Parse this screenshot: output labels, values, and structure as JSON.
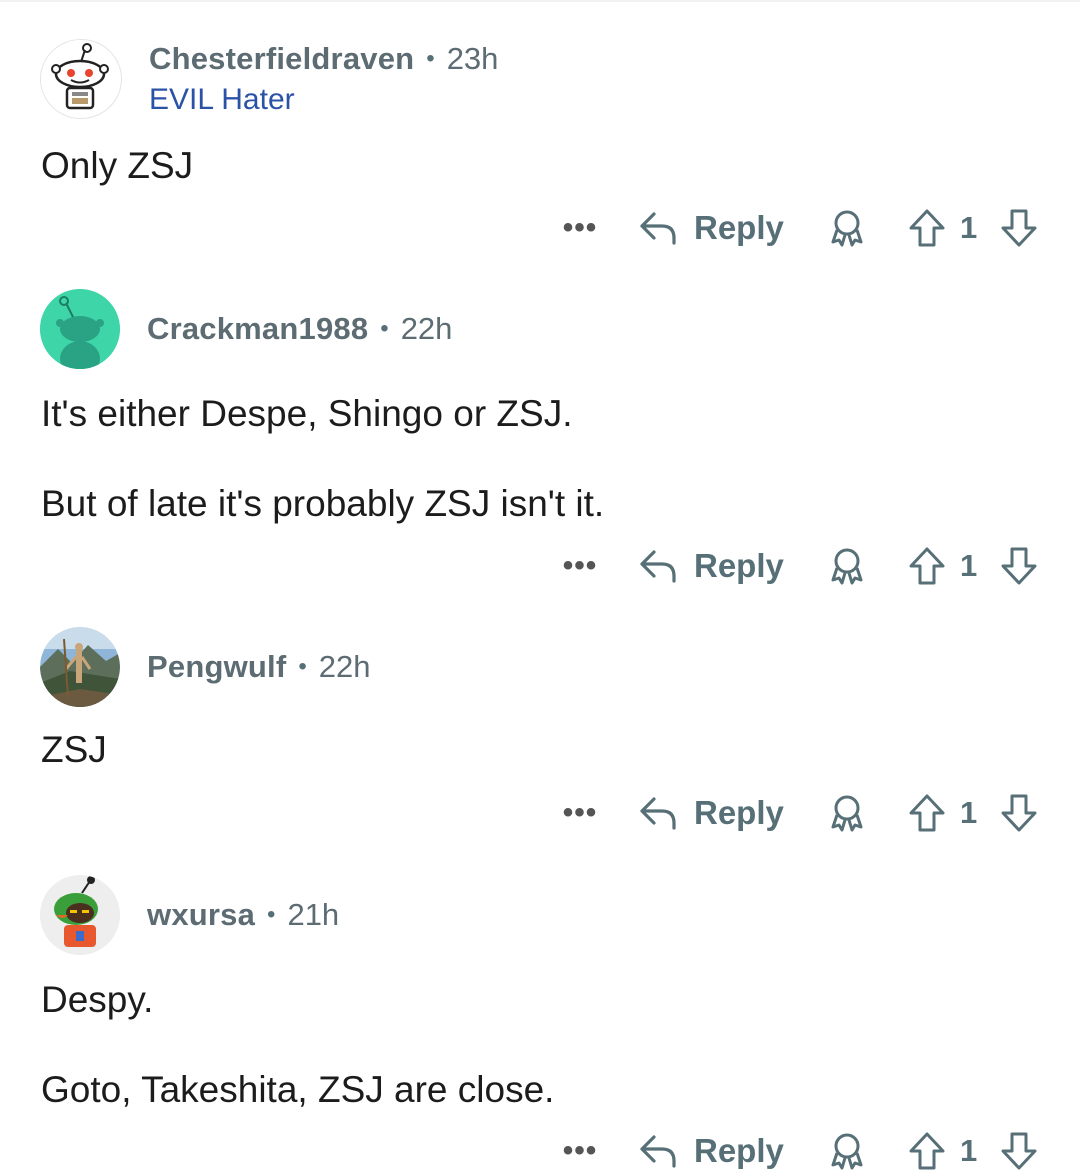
{
  "comments": [
    {
      "username": "Chesterfieldraven",
      "separator": "•",
      "time": "23h",
      "flair": "EVIL Hater",
      "body": [
        "Only ZSJ"
      ],
      "more": "•••",
      "reply_label": "Reply",
      "score": "1",
      "avatar_icon": "snoo-robot-avatar",
      "flair_color": "#2a52a6"
    },
    {
      "username": "Crackman1988",
      "separator": "•",
      "time": "22h",
      "body": [
        "It's either Despe, Shingo or ZSJ.",
        "But of late it's probably ZSJ isn't it."
      ],
      "more": "•••",
      "reply_label": "Reply",
      "score": "1",
      "avatar_icon": "snoo-default-avatar",
      "avatar_color": "#3ed6a8"
    },
    {
      "username": "Pengwulf",
      "separator": "•",
      "time": "22h",
      "body": [
        "ZSJ"
      ],
      "more": "•••",
      "reply_label": "Reply",
      "score": "1",
      "avatar_icon": "landscape-photo-avatar"
    },
    {
      "username": "wxursa",
      "separator": "•",
      "time": "21h",
      "body": [
        "Despy.",
        "Goto, Takeshita, ZSJ are close."
      ],
      "more": "•••",
      "reply_label": "Reply",
      "score": "1",
      "avatar_icon": "snoo-costume-avatar"
    }
  ],
  "icons": {
    "reply": "reply-arrow-icon",
    "award": "award-icon",
    "upvote": "upvote-arrow-icon",
    "downvote": "downvote-arrow-icon",
    "more": "more-dots-icon"
  },
  "colors": {
    "meta_text": "#576f76",
    "body_text": "#1c1c1c",
    "flair": "#2a52a6"
  }
}
